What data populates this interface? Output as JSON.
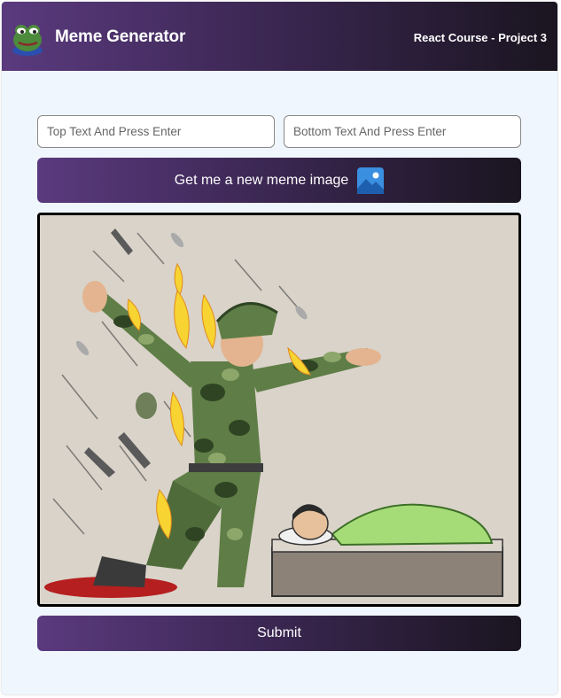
{
  "header": {
    "title": "Meme Generator",
    "course": "React Course - Project 3",
    "logo_icon": "frog-logo-icon",
    "brand_gradient": [
      "#5a3a7e",
      "#1a1520"
    ]
  },
  "form": {
    "top_text": {
      "value": "",
      "placeholder": "Top Text And Press Enter"
    },
    "bottom_text": {
      "value": "",
      "placeholder": "Bottom Text And Press Enter"
    },
    "new_image_label": "Get me a new meme image",
    "new_image_icon": "picture-icon",
    "submit_label": "Submit"
  },
  "meme": {
    "description_icon": "soldier-protecting-sleeping-child-image"
  }
}
